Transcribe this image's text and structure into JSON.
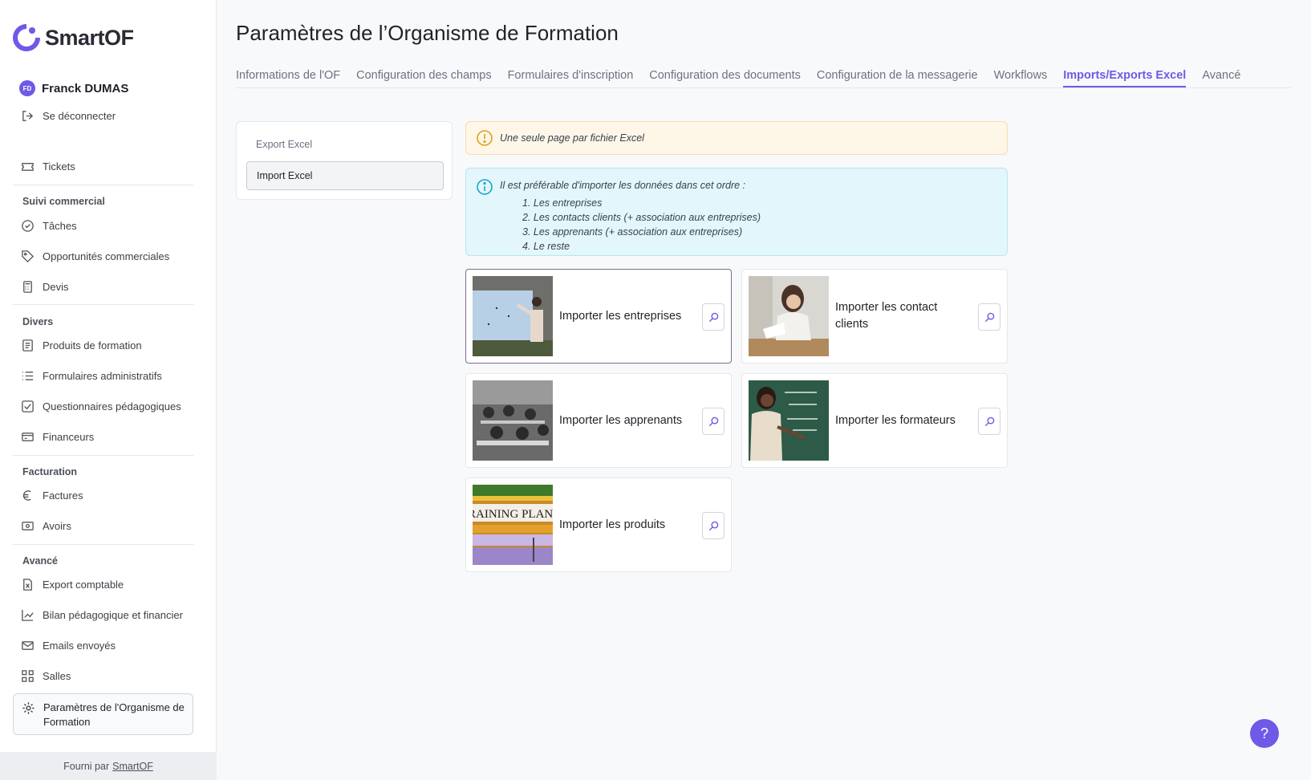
{
  "app": {
    "logo_text": "SmartOF"
  },
  "user": {
    "initials": "FD",
    "name": "Franck DUMAS",
    "logout_label": "Se déconnecter"
  },
  "sidebar": {
    "tickets": "Tickets",
    "sections": {
      "commercial": "Suivi commercial",
      "divers": "Divers",
      "facturation": "Facturation",
      "avance": "Avancé"
    },
    "items": {
      "taches": "Tâches",
      "opportunites": "Opportunités commerciales",
      "devis": "Devis",
      "produits": "Produits de formation",
      "formulaires": "Formulaires administratifs",
      "questionnaires": "Questionnaires pédagogiques",
      "financeurs": "Financeurs",
      "factures": "Factures",
      "avoirs": "Avoirs",
      "export_comptable": "Export comptable",
      "bilan": "Bilan pédagogique et financier",
      "emails": "Emails envoyés",
      "salles": "Salles",
      "parametres": "Paramètres de l'Organisme de Formation"
    },
    "footer_prefix": "Fourni par",
    "footer_link": "SmartOF"
  },
  "page": {
    "title": "Paramètres de l’Organisme de Formation"
  },
  "tabs": [
    {
      "label": "Informations de l'OF"
    },
    {
      "label": "Configuration des champs"
    },
    {
      "label": "Formulaires d'inscription"
    },
    {
      "label": "Configuration des documents"
    },
    {
      "label": "Configuration de la messagerie"
    },
    {
      "label": "Workflows"
    },
    {
      "label": "Imports/Exports Excel",
      "active": true
    },
    {
      "label": "Avancé"
    }
  ],
  "subnav": {
    "export": "Export Excel",
    "import": "Import Excel"
  },
  "alerts": {
    "warning": "Une seule page par fichier Excel",
    "info_head": "Il est préférable d'importer les données dans cet ordre :",
    "info_items": [
      "1. Les entreprises",
      "2. Les contacts clients (+ association aux entreprises)",
      "3. Les apprenants (+ association aux entreprises)",
      "4. Le reste"
    ]
  },
  "cards": [
    {
      "label": "Importer les entreprises"
    },
    {
      "label": "Importer les contact clients"
    },
    {
      "label": "Importer les apprenants"
    },
    {
      "label": "Importer les formateurs"
    },
    {
      "label": "Importer les produits",
      "image_text": "RAINING PLAN"
    }
  ],
  "help": {
    "label": "?"
  },
  "colors": {
    "accent": "#6d5ae6",
    "warning_bg": "#fef6e7",
    "info_bg": "#e3f6fb"
  }
}
